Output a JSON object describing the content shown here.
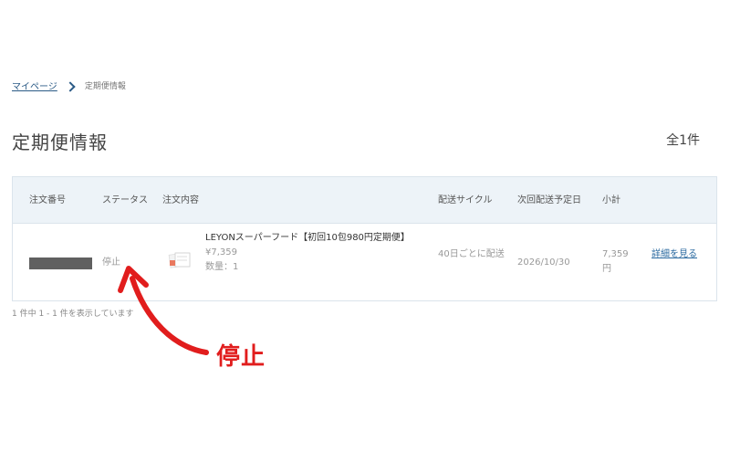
{
  "breadcrumb": {
    "home": "マイページ",
    "current": "定期便情報"
  },
  "title": "定期便情報",
  "total_count": "全1件",
  "table": {
    "headers": [
      "注文番号",
      "ステータス",
      "注文内容",
      "配送サイクル",
      "次回配送予定日",
      "小計"
    ],
    "rows": [
      {
        "status": "停止",
        "product_name": "LEYONスーパーフード【初回10包980円定期便】",
        "product_price": "¥7,359",
        "product_qty": "数量：1",
        "cycle": "40日ごとに配送",
        "next_date": "2026/10/30",
        "subtotal": "7,359円",
        "detail_link": "詳細を見る"
      }
    ]
  },
  "footer": "1 件中 1 - 1 件を表示しています",
  "annotation": {
    "label": "停止",
    "color": "#e11d1d"
  },
  "colors": {
    "link": "#2b5b86",
    "header_bg": "#edf3f8",
    "border": "#dbe4ec"
  }
}
